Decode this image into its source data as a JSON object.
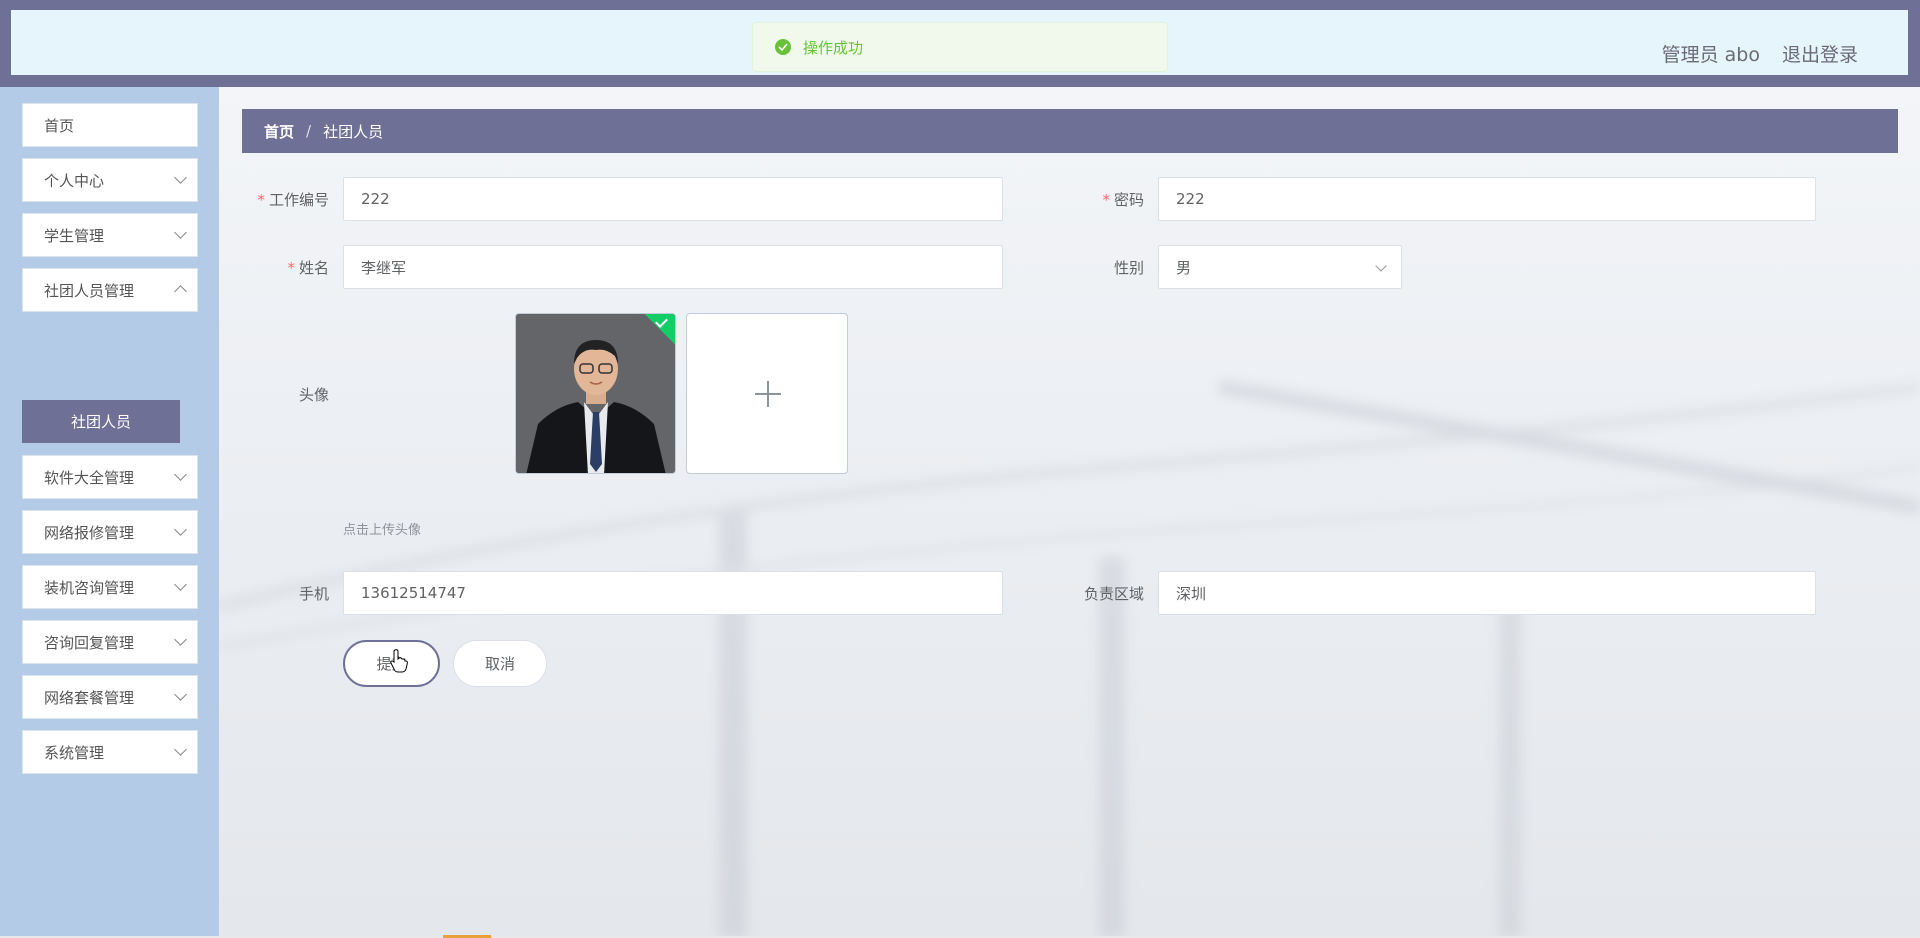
{
  "header": {
    "user_label": "管理员 abo",
    "logout_label": "退出登录"
  },
  "toast": {
    "message": "操作成功",
    "color": "#67c23a"
  },
  "sidebar": {
    "items": [
      {
        "label": "首页"
      },
      {
        "label": "个人中心"
      },
      {
        "label": "学生管理"
      },
      {
        "label": "社团人员管理"
      },
      {
        "label": "软件大全管理"
      },
      {
        "label": "网络报修管理"
      },
      {
        "label": "装机咨询管理"
      },
      {
        "label": "咨询回复管理"
      },
      {
        "label": "网络套餐管理"
      },
      {
        "label": "系统管理"
      }
    ],
    "active_sub": "社团人员"
  },
  "breadcrumb": {
    "home": "首页",
    "separator": "/",
    "current": "社团人员"
  },
  "form": {
    "work_no": {
      "label": "工作编号",
      "value": "222"
    },
    "password": {
      "label": "密码",
      "value": "222"
    },
    "name": {
      "label": "姓名",
      "value": "李继军"
    },
    "gender": {
      "label": "性别",
      "value": "男"
    },
    "avatar": {
      "label": "头像",
      "tip": "点击上传头像"
    },
    "phone": {
      "label": "手机",
      "value": "13612514747"
    },
    "area": {
      "label": "负责区域",
      "value": "深圳"
    },
    "submit_label": "提交",
    "cancel_label": "取消"
  },
  "colors": {
    "primary": "#6f7096",
    "sidebar_bg": "#b3cbe6",
    "header_inner": "#e6f4fb",
    "required": "#f56c6c"
  }
}
